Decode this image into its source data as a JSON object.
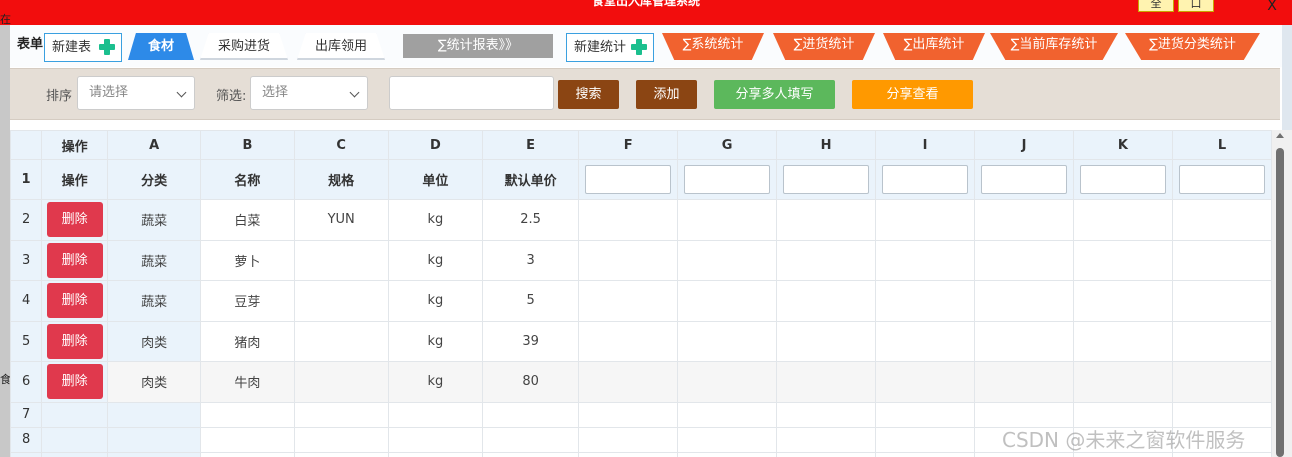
{
  "window": {
    "title": "食堂出入库管理系统",
    "full_label": "全",
    "max_label": "口",
    "close_label": "X"
  },
  "left_edge": {
    "char_top": "在",
    "char_bottom": "食"
  },
  "tabbar": {
    "label": "表单",
    "new_table": "新建表",
    "tabs": [
      {
        "label": "食材",
        "active": true
      },
      {
        "label": "采购进货",
        "active": false
      },
      {
        "label": "出库领用",
        "active": false
      }
    ],
    "report_tab": "∑统计报表》》",
    "new_stat": "新建统计",
    "stats": [
      "∑系统统计",
      "∑进货统计",
      "∑出库统计",
      "∑当前库存统计",
      "∑进货分类统计"
    ]
  },
  "toolbar": {
    "sort_label": "排序",
    "sort_placeholder": "请选择",
    "filter_label": "筛选:",
    "filter_placeholder": "选择",
    "search_value": "",
    "search_btn": "搜索",
    "add_btn": "添加",
    "share_multi_btn": "分享多人填写",
    "share_view_btn": "分享查看",
    "colors": {
      "search": "#8b4513",
      "add": "#8b4513",
      "share_multi": "#5cb85c",
      "share_view": "#ff9900"
    }
  },
  "grid": {
    "col_letters": [
      "操作",
      "A",
      "B",
      "C",
      "D",
      "E",
      "F",
      "G",
      "H",
      "I",
      "J",
      "K",
      "L"
    ],
    "header_row": {
      "num": "1",
      "cells": [
        "操作",
        "分类",
        "名称",
        "规格",
        "单位",
        "默认单价"
      ]
    },
    "delete_label": "删除",
    "rows": [
      {
        "num": "2",
        "A": "蔬菜",
        "B": "白菜",
        "C": "YUN",
        "D": "kg",
        "E": "2.5"
      },
      {
        "num": "3",
        "A": "蔬菜",
        "B": "萝卜",
        "C": "",
        "D": "kg",
        "E": "3"
      },
      {
        "num": "4",
        "A": "蔬菜",
        "B": "豆芽",
        "C": "",
        "D": "kg",
        "E": "5"
      },
      {
        "num": "5",
        "A": "肉类",
        "B": "猪肉",
        "C": "",
        "D": "kg",
        "E": "39"
      },
      {
        "num": "6",
        "A": "肉类",
        "B": "牛肉",
        "C": "",
        "D": "kg",
        "E": "80"
      }
    ],
    "empty_rows": [
      "7",
      "8"
    ]
  },
  "watermark": "CSDN @未来之窗软件服务"
}
